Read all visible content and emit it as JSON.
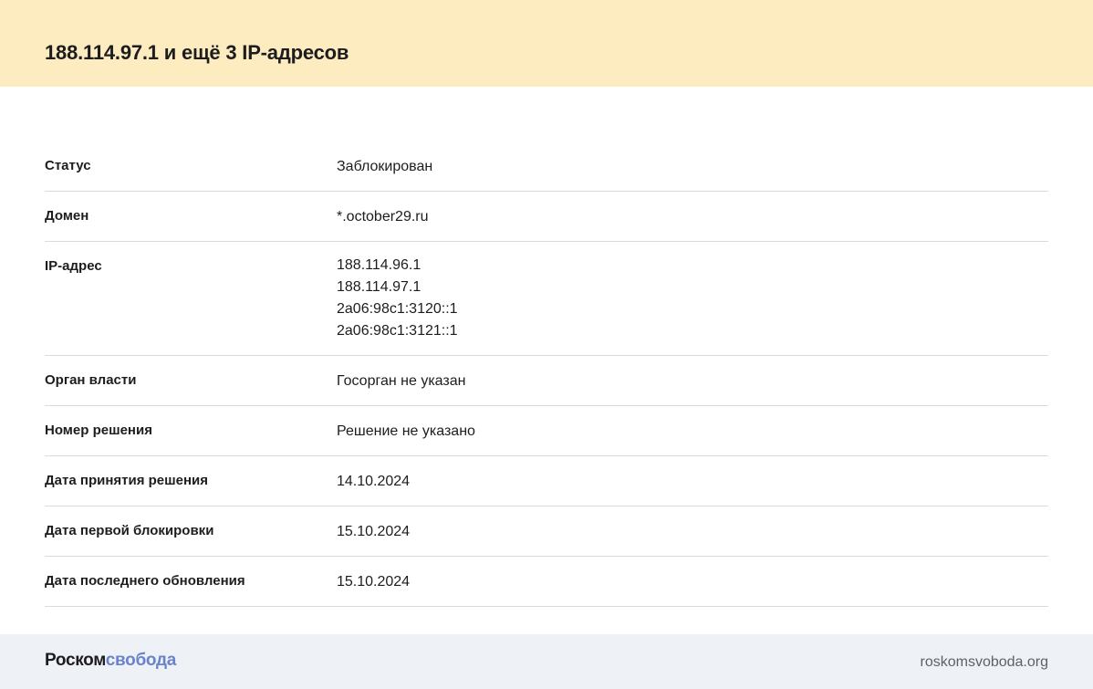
{
  "header": {
    "title": "188.114.97.1 и ещё 3 IP-адресов"
  },
  "details": [
    {
      "label": "Статус",
      "values": [
        "Заблокирован"
      ]
    },
    {
      "label": "Домен",
      "values": [
        "*.october29.ru"
      ]
    },
    {
      "label": "IP-адрес",
      "values": [
        "188.114.96.1",
        "188.114.97.1",
        "2a06:98c1:3120::1",
        "2a06:98c1:3121::1"
      ]
    },
    {
      "label": "Орган власти",
      "values": [
        "Госорган не указан"
      ]
    },
    {
      "label": "Номер решения",
      "values": [
        "Решение не указано"
      ]
    },
    {
      "label": "Дата принятия решения",
      "values": [
        "14.10.2024"
      ]
    },
    {
      "label": "Дата первой блокировки",
      "values": [
        "15.10.2024"
      ]
    },
    {
      "label": "Дата последнего обновления",
      "values": [
        "15.10.2024"
      ]
    }
  ],
  "footer": {
    "logo_part1": "Роском",
    "logo_part2": "свобода",
    "site": "roskomsvoboda.org"
  },
  "colors": {
    "header_bg": "#fdecc0",
    "footer_bg": "#eef1f6",
    "logo_accent": "#6a84c9",
    "divider": "#d9dadd"
  }
}
